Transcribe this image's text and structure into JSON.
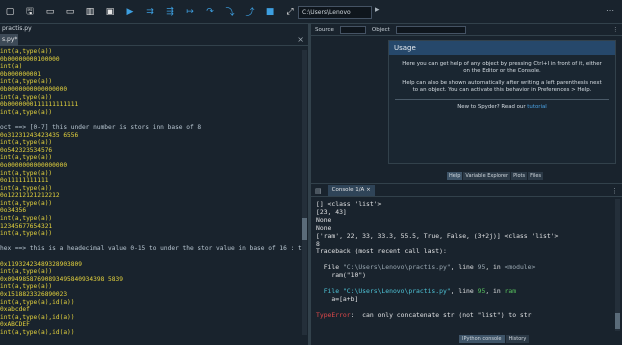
{
  "toolbar": {
    "icons": [
      "new-file-icon",
      "open-folder-icon",
      "save-icon",
      "save-all-icon",
      "new-window-icon",
      "properties-icon",
      "run-icon",
      "run-file-icon",
      "run-cell-icon",
      "run-cell-advance-icon",
      "debug-step-icon",
      "debug-step-into-icon",
      "debug-continue-icon",
      "stop-icon",
      "maximize-icon",
      "wrench-icon",
      "python-icon"
    ],
    "glyphs": [
      "▢",
      "🖫",
      "▭",
      "▭",
      "▥",
      "▣",
      "▶",
      "⇉",
      "⇶",
      "↦",
      "↷",
      "⤵",
      "⤴",
      "■",
      "⤢",
      "🔧",
      "⚙"
    ],
    "path": "C:\\Users\\Lenovo",
    "path_arrow": "▸",
    "path_dots": "⋯"
  },
  "editor": {
    "title": "practis.py",
    "tab": "s.py*",
    "tab_controls": "×",
    "lines": [
      {
        "t": "int(a,type(a))",
        "c": "c-y"
      },
      {
        "t": "0b00000000100000",
        "c": "c-y"
      },
      {
        "t": "int(a)",
        "c": "c-y"
      },
      {
        "t": "0b000000001",
        "c": "c-y"
      },
      {
        "t": "int(a,type(a))",
        "c": "c-y"
      },
      {
        "t": "0b0000000000000000",
        "c": "c-y"
      },
      {
        "t": "int(a,type(a))",
        "c": "c-y"
      },
      {
        "t": "0b0000000111111111111",
        "c": "c-y"
      },
      {
        "t": "int(a,type(a))",
        "c": "c-y"
      },
      {
        "t": "",
        "c": "c-w"
      },
      {
        "t": "oct ==> [0-7] this under number is stors inn base of 8",
        "c": "c-c"
      },
      {
        "t": "0o31231243423435 6556",
        "c": "c-y"
      },
      {
        "t": "int(a,type(a))",
        "c": "c-y"
      },
      {
        "t": "0o542323534576",
        "c": "c-y"
      },
      {
        "t": "int(a,type(a))",
        "c": "c-y"
      },
      {
        "t": "0o0000000000000000",
        "c": "c-y"
      },
      {
        "t": "int(a,type(a))",
        "c": "c-y"
      },
      {
        "t": "0o11111111111",
        "c": "c-y"
      },
      {
        "t": "int(a,type(a))",
        "c": "c-y"
      },
      {
        "t": "0o12212121212212",
        "c": "c-y"
      },
      {
        "t": "int(a,type(a))",
        "c": "c-y"
      },
      {
        "t": "0o34356",
        "c": "c-y"
      },
      {
        "t": "int(a,type(a))",
        "c": "c-y"
      },
      {
        "t": "12345677654321",
        "c": "c-y"
      },
      {
        "t": "int(a,type(a))",
        "c": "c-y"
      },
      {
        "t": "",
        "c": "c-w"
      },
      {
        "t": "hex ==> this is a headecimal value 0-15 to under the stor value in base of 16 : to 10-15 st",
        "c": "c-c"
      },
      {
        "t": "",
        "c": "c-w"
      },
      {
        "t": "0x11932423489328903809",
        "c": "c-y"
      },
      {
        "t": "int(a,type(a))",
        "c": "c-y"
      },
      {
        "t": "0x09498587690893495840934398 5839",
        "c": "c-y"
      },
      {
        "t": "int(a,type(a))",
        "c": "c-y"
      },
      {
        "t": "0x1518823326890023",
        "c": "c-y"
      },
      {
        "t": "int(a,type(a),id(a))",
        "c": "c-y"
      },
      {
        "t": "0xabcdef",
        "c": "c-y"
      },
      {
        "t": "int(a,type(a),id(a))",
        "c": "c-y"
      },
      {
        "t": "0xABCDEF",
        "c": "c-y"
      },
      {
        "t": "int(a,type(a),id(a))",
        "c": "c-y"
      }
    ]
  },
  "help": {
    "source_label": "Source",
    "console_label": "Console",
    "object_label": "Object",
    "menu_dots": "⋮",
    "usage_title": "Usage",
    "usage_p1": "Here you can get help of any object by pressing Ctrl+I in front of it, either on the Editor or the Console.",
    "usage_p2": "Help can also be shown automatically after writing a left parenthesis next to an object. You can activate this behavior in Preferences > Help.",
    "usage_foot_prefix": "New to Spyder? Read our",
    "usage_foot_link": "tutorial",
    "tabs": [
      "Help",
      "Variable Explorer",
      "Plots",
      "Files"
    ],
    "active_tab": 0
  },
  "console": {
    "tab": "Console 1/A",
    "tab_close": "×",
    "menu_dots": "⋮",
    "lines": [
      [
        {
          "t": "[] <class 'list'>",
          "c": ""
        }
      ],
      [
        {
          "t": "[23, 43]",
          "c": ""
        }
      ],
      [
        {
          "t": "None",
          "c": ""
        }
      ],
      [
        {
          "t": "None",
          "c": ""
        }
      ],
      [
        {
          "t": "['ram', 22, 33, 33.3, 55.5, True, False, (3+2j)] <class 'list'>",
          "c": ""
        }
      ],
      [
        {
          "t": "8",
          "c": ""
        }
      ],
      [
        {
          "t": "Traceback (most recent call last):",
          "c": ""
        }
      ],
      [
        {
          "t": "",
          "c": ""
        }
      ],
      [
        {
          "t": "  File ",
          "c": ""
        },
        {
          "t": "\"C:\\Users\\Lenovo\\practis.py\"",
          "c": "pale"
        },
        {
          "t": ", line ",
          "c": ""
        },
        {
          "t": "95",
          "c": "pale"
        },
        {
          "t": ", in ",
          "c": ""
        },
        {
          "t": "<module>",
          "c": "pale"
        }
      ],
      [
        {
          "t": "    ram(\"10\")",
          "c": ""
        }
      ],
      [
        {
          "t": "",
          "c": ""
        }
      ],
      [
        {
          "t": "  File ",
          "c": "cy"
        },
        {
          "t": "\"C:\\Users\\Lenovo\\practis.py\"",
          "c": "cy"
        },
        {
          "t": ", line ",
          "c": ""
        },
        {
          "t": "95",
          "c": "grn"
        },
        {
          "t": ", in ",
          "c": ""
        },
        {
          "t": "ram",
          "c": "grn"
        }
      ],
      [
        {
          "t": "    a=[a+b]",
          "c": ""
        }
      ],
      [
        {
          "t": "",
          "c": ""
        }
      ],
      [
        {
          "t": "TypeError",
          "c": "r"
        },
        {
          "t": ":  can only concatenate str (not \"list\") to str",
          "c": ""
        }
      ],
      [
        {
          "t": "",
          "c": ""
        }
      ],
      [
        {
          "t": "",
          "c": ""
        }
      ],
      [
        {
          "t": "In [",
          "c": "grn"
        },
        {
          "t": "10",
          "c": "grn"
        },
        {
          "t": "]: ",
          "c": "grn"
        }
      ]
    ],
    "bottom_tabs": [
      "IPython console",
      "History"
    ],
    "active_bottom": 0
  }
}
